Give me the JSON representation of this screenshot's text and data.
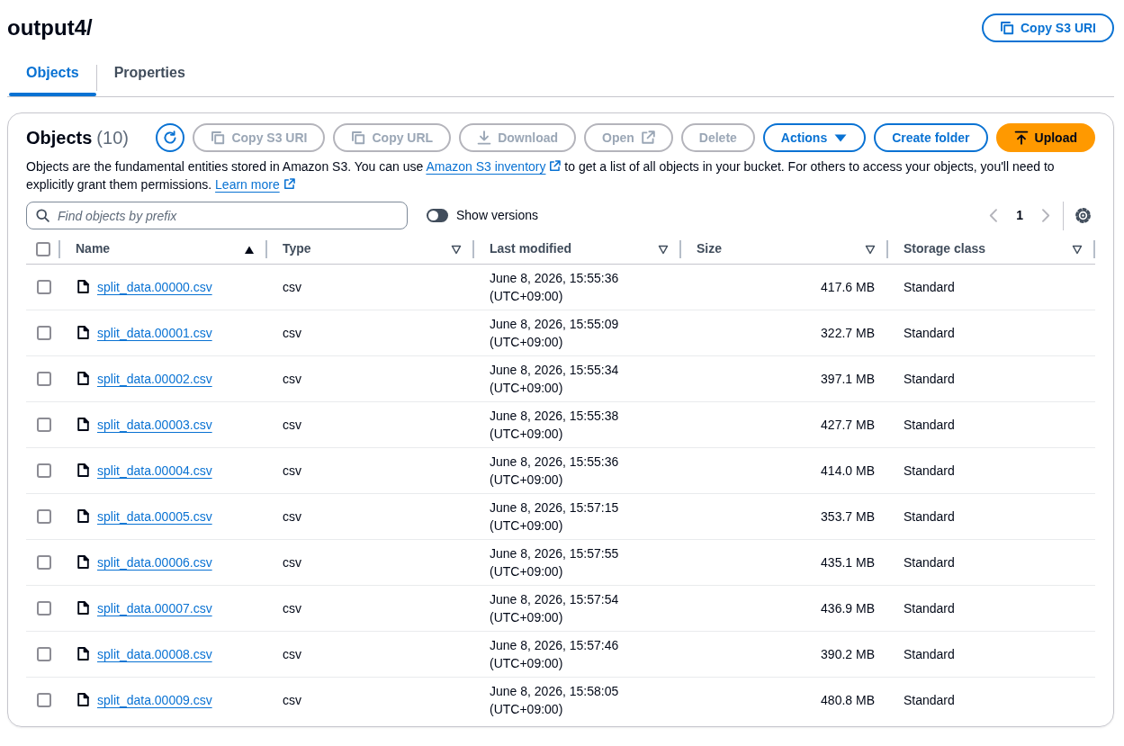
{
  "page_header": {
    "title": "output4/",
    "copy_button": {
      "label": "Copy S3 URI",
      "kind": "copy",
      "disabled": false
    }
  },
  "tabs": [
    {
      "label": "Objects",
      "selected": true
    },
    {
      "label": "Properties",
      "selected": false
    }
  ],
  "objects_panel": {
    "title": "Objects",
    "count": "(10)",
    "buttons": [
      {
        "label": "Copy S3 URI",
        "kind": "copy",
        "disabled": true
      },
      {
        "label": "Copy URL",
        "kind": "copy",
        "disabled": true
      },
      {
        "label": "Download",
        "kind": "download",
        "disabled": true
      },
      {
        "label": "Open",
        "kind": "open",
        "disabled": true
      },
      {
        "label": "Delete",
        "kind": "delete",
        "disabled": true
      },
      {
        "label": "Actions",
        "kind": "actions",
        "disabled": false
      },
      {
        "label": "Create folder",
        "kind": "create",
        "disabled": false
      },
      {
        "label": "Upload",
        "kind": "upload",
        "disabled": false
      }
    ],
    "description": [
      {
        "kind": "text",
        "text": "Objects are the fundamental entities stored in Amazon S3. You can use "
      },
      {
        "kind": "link",
        "text": "Amazon S3 inventory",
        "external": true
      },
      {
        "kind": "text",
        "text": " to get a list of all objects in your bucket. For others to access your objects, you'll need to explicitly grant them permissions. "
      },
      {
        "kind": "link",
        "text": "Learn more",
        "external": true
      }
    ],
    "search": {
      "placeholder": "Find objects by prefix"
    },
    "show_versions": {
      "label": "Show versions",
      "on": false
    },
    "pagination": {
      "prev_disabled": true,
      "next_disabled": true,
      "pages": [
        {
          "label": "1",
          "selected": true
        }
      ]
    },
    "table": {
      "select_all": {
        "checked": false
      },
      "columns": [
        {
          "label": "Name",
          "sorted": true
        },
        {
          "label": "Type",
          "sorted": false
        },
        {
          "label": "Last modified",
          "sorted": false
        },
        {
          "label": "Size",
          "sorted": false
        },
        {
          "label": "Storage class",
          "sorted": false
        }
      ],
      "rows": [
        {
          "selected": false,
          "name": "split_data.00000.csv",
          "type": "csv",
          "last_modified": "June 8, 2026, 15:55:36 (UTC+09:00)",
          "size": "417.6 MB",
          "storage_class": "Standard"
        },
        {
          "selected": false,
          "name": "split_data.00001.csv",
          "type": "csv",
          "last_modified": "June 8, 2026, 15:55:09 (UTC+09:00)",
          "size": "322.7 MB",
          "storage_class": "Standard"
        },
        {
          "selected": false,
          "name": "split_data.00002.csv",
          "type": "csv",
          "last_modified": "June 8, 2026, 15:55:34 (UTC+09:00)",
          "size": "397.1 MB",
          "storage_class": "Standard"
        },
        {
          "selected": false,
          "name": "split_data.00003.csv",
          "type": "csv",
          "last_modified": "June 8, 2026, 15:55:38 (UTC+09:00)",
          "size": "427.7 MB",
          "storage_class": "Standard"
        },
        {
          "selected": false,
          "name": "split_data.00004.csv",
          "type": "csv",
          "last_modified": "June 8, 2026, 15:55:36 (UTC+09:00)",
          "size": "414.0 MB",
          "storage_class": "Standard"
        },
        {
          "selected": false,
          "name": "split_data.00005.csv",
          "type": "csv",
          "last_modified": "June 8, 2026, 15:57:15 (UTC+09:00)",
          "size": "353.7 MB",
          "storage_class": "Standard"
        },
        {
          "selected": false,
          "name": "split_data.00006.csv",
          "type": "csv",
          "last_modified": "June 8, 2026, 15:57:55 (UTC+09:00)",
          "size": "435.1 MB",
          "storage_class": "Standard"
        },
        {
          "selected": false,
          "name": "split_data.00007.csv",
          "type": "csv",
          "last_modified": "June 8, 2026, 15:57:54 (UTC+09:00)",
          "size": "436.9 MB",
          "storage_class": "Standard"
        },
        {
          "selected": false,
          "name": "split_data.00008.csv",
          "type": "csv",
          "last_modified": "June 8, 2026, 15:57:46 (UTC+09:00)",
          "size": "390.2 MB",
          "storage_class": "Standard"
        },
        {
          "selected": false,
          "name": "split_data.00009.csv",
          "type": "csv",
          "last_modified": "June 8, 2026, 15:58:05 (UTC+09:00)",
          "size": "480.8 MB",
          "storage_class": "Standard"
        }
      ]
    }
  }
}
